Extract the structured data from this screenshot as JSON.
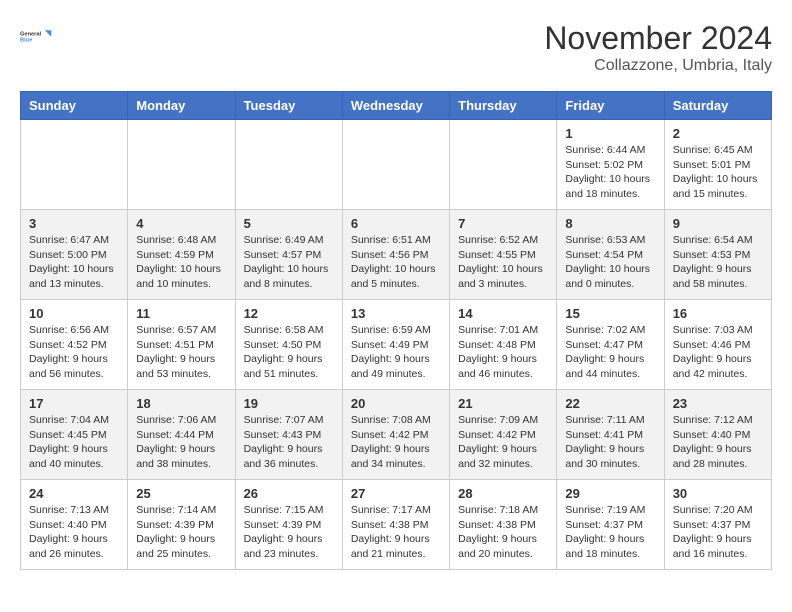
{
  "header": {
    "logo_line1": "General",
    "logo_line2": "Blue",
    "month_title": "November 2024",
    "location": "Collazzone, Umbria, Italy"
  },
  "weekdays": [
    "Sunday",
    "Monday",
    "Tuesday",
    "Wednesday",
    "Thursday",
    "Friday",
    "Saturday"
  ],
  "weeks": [
    [
      {
        "day": "",
        "info": ""
      },
      {
        "day": "",
        "info": ""
      },
      {
        "day": "",
        "info": ""
      },
      {
        "day": "",
        "info": ""
      },
      {
        "day": "",
        "info": ""
      },
      {
        "day": "1",
        "info": "Sunrise: 6:44 AM\nSunset: 5:02 PM\nDaylight: 10 hours\nand 18 minutes."
      },
      {
        "day": "2",
        "info": "Sunrise: 6:45 AM\nSunset: 5:01 PM\nDaylight: 10 hours\nand 15 minutes."
      }
    ],
    [
      {
        "day": "3",
        "info": "Sunrise: 6:47 AM\nSunset: 5:00 PM\nDaylight: 10 hours\nand 13 minutes."
      },
      {
        "day": "4",
        "info": "Sunrise: 6:48 AM\nSunset: 4:59 PM\nDaylight: 10 hours\nand 10 minutes."
      },
      {
        "day": "5",
        "info": "Sunrise: 6:49 AM\nSunset: 4:57 PM\nDaylight: 10 hours\nand 8 minutes."
      },
      {
        "day": "6",
        "info": "Sunrise: 6:51 AM\nSunset: 4:56 PM\nDaylight: 10 hours\nand 5 minutes."
      },
      {
        "day": "7",
        "info": "Sunrise: 6:52 AM\nSunset: 4:55 PM\nDaylight: 10 hours\nand 3 minutes."
      },
      {
        "day": "8",
        "info": "Sunrise: 6:53 AM\nSunset: 4:54 PM\nDaylight: 10 hours\nand 0 minutes."
      },
      {
        "day": "9",
        "info": "Sunrise: 6:54 AM\nSunset: 4:53 PM\nDaylight: 9 hours\nand 58 minutes."
      }
    ],
    [
      {
        "day": "10",
        "info": "Sunrise: 6:56 AM\nSunset: 4:52 PM\nDaylight: 9 hours\nand 56 minutes."
      },
      {
        "day": "11",
        "info": "Sunrise: 6:57 AM\nSunset: 4:51 PM\nDaylight: 9 hours\nand 53 minutes."
      },
      {
        "day": "12",
        "info": "Sunrise: 6:58 AM\nSunset: 4:50 PM\nDaylight: 9 hours\nand 51 minutes."
      },
      {
        "day": "13",
        "info": "Sunrise: 6:59 AM\nSunset: 4:49 PM\nDaylight: 9 hours\nand 49 minutes."
      },
      {
        "day": "14",
        "info": "Sunrise: 7:01 AM\nSunset: 4:48 PM\nDaylight: 9 hours\nand 46 minutes."
      },
      {
        "day": "15",
        "info": "Sunrise: 7:02 AM\nSunset: 4:47 PM\nDaylight: 9 hours\nand 44 minutes."
      },
      {
        "day": "16",
        "info": "Sunrise: 7:03 AM\nSunset: 4:46 PM\nDaylight: 9 hours\nand 42 minutes."
      }
    ],
    [
      {
        "day": "17",
        "info": "Sunrise: 7:04 AM\nSunset: 4:45 PM\nDaylight: 9 hours\nand 40 minutes."
      },
      {
        "day": "18",
        "info": "Sunrise: 7:06 AM\nSunset: 4:44 PM\nDaylight: 9 hours\nand 38 minutes."
      },
      {
        "day": "19",
        "info": "Sunrise: 7:07 AM\nSunset: 4:43 PM\nDaylight: 9 hours\nand 36 minutes."
      },
      {
        "day": "20",
        "info": "Sunrise: 7:08 AM\nSunset: 4:42 PM\nDaylight: 9 hours\nand 34 minutes."
      },
      {
        "day": "21",
        "info": "Sunrise: 7:09 AM\nSunset: 4:42 PM\nDaylight: 9 hours\nand 32 minutes."
      },
      {
        "day": "22",
        "info": "Sunrise: 7:11 AM\nSunset: 4:41 PM\nDaylight: 9 hours\nand 30 minutes."
      },
      {
        "day": "23",
        "info": "Sunrise: 7:12 AM\nSunset: 4:40 PM\nDaylight: 9 hours\nand 28 minutes."
      }
    ],
    [
      {
        "day": "24",
        "info": "Sunrise: 7:13 AM\nSunset: 4:40 PM\nDaylight: 9 hours\nand 26 minutes."
      },
      {
        "day": "25",
        "info": "Sunrise: 7:14 AM\nSunset: 4:39 PM\nDaylight: 9 hours\nand 25 minutes."
      },
      {
        "day": "26",
        "info": "Sunrise: 7:15 AM\nSunset: 4:39 PM\nDaylight: 9 hours\nand 23 minutes."
      },
      {
        "day": "27",
        "info": "Sunrise: 7:17 AM\nSunset: 4:38 PM\nDaylight: 9 hours\nand 21 minutes."
      },
      {
        "day": "28",
        "info": "Sunrise: 7:18 AM\nSunset: 4:38 PM\nDaylight: 9 hours\nand 20 minutes."
      },
      {
        "day": "29",
        "info": "Sunrise: 7:19 AM\nSunset: 4:37 PM\nDaylight: 9 hours\nand 18 minutes."
      },
      {
        "day": "30",
        "info": "Sunrise: 7:20 AM\nSunset: 4:37 PM\nDaylight: 9 hours\nand 16 minutes."
      }
    ]
  ]
}
